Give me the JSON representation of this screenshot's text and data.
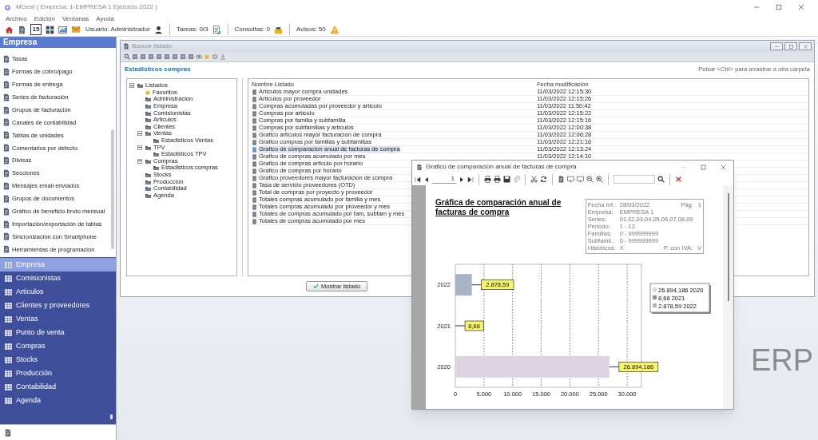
{
  "window": {
    "title": "MGest ( Empresa: 1-EMPRESA 1 Ejercicio 2022 )"
  },
  "menu": [
    "Archivo",
    "Edición",
    "Ventanas",
    "Ayuda"
  ],
  "toolbar": {
    "calendar_day": "15",
    "user": "Usuario: Administrador",
    "tasks": "Tareas: 0/3",
    "queries": "Consultas: 0",
    "alerts": "Avisos: 50"
  },
  "sidebar": {
    "header": "Empresa",
    "items": [
      "Tasas",
      "Formas de cobro/pago",
      "Formas de entrega",
      "Series de facturación",
      "Grupos de facturación",
      "Canales de contabilidad",
      "Tablas de unidades",
      "Comentarios por defecto",
      "Divisas",
      "Secciones",
      "Mensajes email enviados",
      "Grupos de documentos",
      "Gráfico de beneficio bruto mensual",
      "Importación/exportación de tablas",
      "Sincronización con Smartphone",
      "Herramientas de programación"
    ],
    "modules": [
      {
        "label": "Empresa",
        "selected": true
      },
      {
        "label": "Comisionistas",
        "selected": false
      },
      {
        "label": "Articulos",
        "selected": false
      },
      {
        "label": "Clientes y proveedores",
        "selected": false
      },
      {
        "label": "Ventas",
        "selected": false
      },
      {
        "label": "Punto de venta",
        "selected": false
      },
      {
        "label": "Compras",
        "selected": false
      },
      {
        "label": "Stocks",
        "selected": false
      },
      {
        "label": "Producción",
        "selected": false
      },
      {
        "label": "Contabilidad",
        "selected": false
      },
      {
        "label": "Agenda",
        "selected": false
      }
    ]
  },
  "background_logo": "ERP",
  "list_window": {
    "title": "Buscar listado",
    "heading": "Estadisticos compras",
    "hint": "Pulsar <Ctrl> para arrastrar a otra carpeta",
    "tree": [
      {
        "label": "Listados",
        "expanded": true,
        "children": [
          {
            "label": "Favoritos",
            "kind": "favorite"
          },
          {
            "label": "Administracion",
            "kind": "folder"
          },
          {
            "label": "Empresa",
            "kind": "folder"
          },
          {
            "label": "Comisionistas",
            "kind": "folder"
          },
          {
            "label": "Articulos",
            "kind": "folder"
          },
          {
            "label": "Clientes",
            "kind": "folder"
          },
          {
            "label": "Ventas",
            "kind": "folder",
            "expanded": true,
            "children": [
              {
                "label": "Estadisticos Ventas",
                "kind": "folder"
              }
            ]
          },
          {
            "label": "TPV",
            "kind": "folder",
            "expanded": true,
            "children": [
              {
                "label": "Estadisticos TPV",
                "kind": "folder"
              }
            ]
          },
          {
            "label": "Compras",
            "kind": "folder",
            "expanded": true,
            "children": [
              {
                "label": "Estadisticos compras",
                "kind": "folder"
              }
            ]
          },
          {
            "label": "Stocks",
            "kind": "folder"
          },
          {
            "label": "Produccion",
            "kind": "folder"
          },
          {
            "label": "Contabilidad",
            "kind": "folder"
          },
          {
            "label": "Agenda",
            "kind": "folder"
          }
        ],
        "kind": "folder"
      }
    ],
    "columns": [
      "Nombre Listado",
      "Fecha modificación"
    ],
    "rows": [
      {
        "name": "Articulos mayor compra unidades",
        "date": "11/03/2022 12:15:30",
        "selected": false
      },
      {
        "name": "Articulos por proveedor",
        "date": "11/03/2022 12:15:26",
        "selected": false
      },
      {
        "name": "Compras acumuladas por proveedor y articulo",
        "date": "11/03/2022 11:50:42",
        "selected": false
      },
      {
        "name": "Compras por articulo",
        "date": "11/03/2022 12:15:22",
        "selected": false
      },
      {
        "name": "Compras por familia y subfamilia",
        "date": "11/03/2022 12:15:16",
        "selected": false
      },
      {
        "name": "Compras por subfamilias y articulos",
        "date": "11/03/2022 12:00:38",
        "selected": false
      },
      {
        "name": "Grafico articulos mayor facturacion de compra",
        "date": "11/03/2022 12:06:28",
        "selected": false
      },
      {
        "name": "Grafico compras por familias y subfamilias",
        "date": "11/03/2022 12:21:16",
        "selected": false
      },
      {
        "name": "Grafico de comparacion anual de facturas de compra",
        "date": "11/03/2022 12:13:24",
        "selected": true
      },
      {
        "name": "Grafico de compras acumulado por mes",
        "date": "11/03/2022 12:14:10",
        "selected": false
      },
      {
        "name": "Grafico de compras articulo por horario",
        "selected": false
      },
      {
        "name": "Grafico de compras por horario",
        "selected": false
      },
      {
        "name": "Grafico proveedores mayor facturacion de compra",
        "selected": false
      },
      {
        "name": "Tasa de servicio proveedores (OTD)",
        "selected": false
      },
      {
        "name": "Total de compras por proyecto y proveedor",
        "selected": false
      },
      {
        "name": "Totales compras acumulado por familia y mes",
        "selected": false
      },
      {
        "name": "Totales compras acumulado por proveedor y mes",
        "selected": false
      },
      {
        "name": "Totales de compras acumulado por fam, subfam y mes",
        "selected": false
      },
      {
        "name": "Totales de compras acumulado por mes",
        "selected": false
      }
    ],
    "button": "Mostrar listado"
  },
  "report_window": {
    "title": "Grafico de comparacion anual de facturas de compra",
    "page": "1",
    "report": {
      "title": "Gráfica de comparación anual de facturas de compra",
      "info": [
        [
          "Fecha Inf.:",
          "28/03/2022",
          "Pág:",
          "1"
        ],
        [
          "Empresa:",
          "EMPRESA 1"
        ],
        [
          "Series:",
          "01,02,03,04,05,06,07,08,09"
        ],
        [
          "Periodo:",
          "1 - 12"
        ],
        [
          "Familias:",
          "0 - 999999999"
        ],
        [
          "Subfamil.:",
          "0 - 999999999"
        ],
        [
          "Históricos:",
          "X",
          "P. con IVA:",
          "V"
        ]
      ],
      "legend": [
        {
          "label": "26.894,186 2020",
          "color": "#ddd3e3"
        },
        {
          "label": "8,68 2021",
          "color": "#8a90b8"
        },
        {
          "label": "2.878,59 2022",
          "color": "#a9b5c7"
        }
      ],
      "chart_data": {
        "type": "bar",
        "orientation": "horizontal",
        "categories": [
          "2022",
          "2021",
          "2020"
        ],
        "series": [
          {
            "values": [
              2878.59,
              8.68,
              26894.186
            ]
          }
        ],
        "grid": true,
        "value_labels": [
          "2.878,59",
          "8,68",
          "26.894,186"
        ],
        "xlim": [
          0,
          32500
        ],
        "xticks": [
          {
            "value": 0,
            "label": "0"
          },
          {
            "value": 5000,
            "label": "5.000"
          },
          {
            "value": 10000,
            "label": "10.000"
          },
          {
            "value": 15000,
            "label": "15.000"
          },
          {
            "value": 20000,
            "label": "20.000"
          },
          {
            "value": 25000,
            "label": "25.000"
          },
          {
            "value": 30000,
            "label": "30.000"
          }
        ]
      }
    }
  }
}
